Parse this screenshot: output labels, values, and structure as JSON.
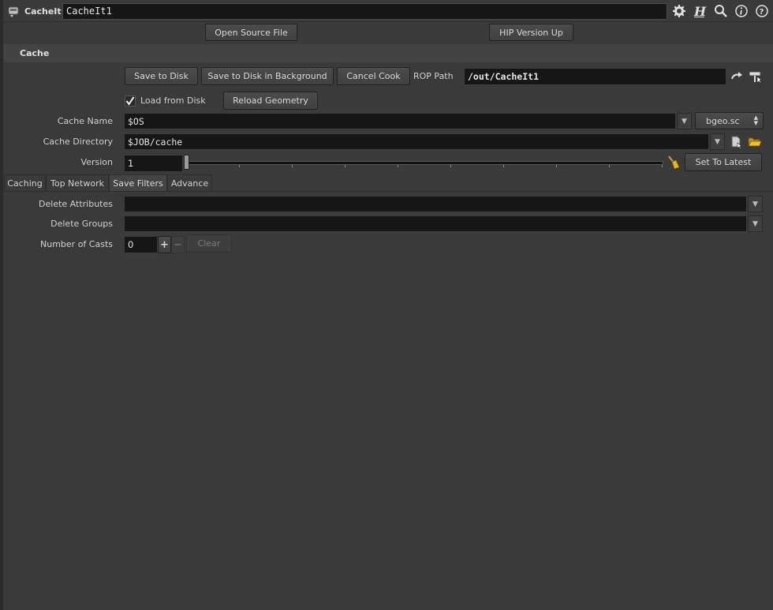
{
  "header": {
    "node_type": "CacheIt",
    "node_name": "CacheIt1",
    "icons": [
      "gear-icon",
      "houdini-h-icon",
      "search-icon",
      "info-icon",
      "help-icon"
    ]
  },
  "top_buttons": {
    "open_source": "Open Source File",
    "hip_version_up": "HIP Version Up"
  },
  "section": {
    "title": "Cache"
  },
  "cook_buttons": {
    "save_to_disk": "Save to Disk",
    "save_background": "Save to Disk in Background",
    "cancel_cook": "Cancel Cook"
  },
  "rop": {
    "label": "ROP Path",
    "value": "/out/CacheIt1"
  },
  "load": {
    "label": "Load from Disk",
    "checked": true,
    "reload": "Reload Geometry"
  },
  "cache_name": {
    "label": "Cache Name",
    "value": "$OS",
    "format": "bgeo.sc"
  },
  "cache_dir": {
    "label": "Cache Directory",
    "value": "$JOB/cache"
  },
  "version": {
    "label": "Version",
    "value": "1",
    "set_latest": "Set To Latest"
  },
  "tabs": [
    {
      "label": "Caching",
      "active": false
    },
    {
      "label": "Top Network",
      "active": false
    },
    {
      "label": "Save Filters",
      "active": true
    },
    {
      "label": "Advance",
      "active": false
    }
  ],
  "filters": {
    "delete_attributes": {
      "label": "Delete Attributes",
      "value": ""
    },
    "delete_groups": {
      "label": "Delete Groups",
      "value": ""
    },
    "number_of_casts": {
      "label": "Number of Casts",
      "value": "0",
      "plus": "+",
      "minus": "−",
      "clear": "Clear"
    }
  },
  "colors": {
    "background": "#3a3a3a",
    "field": "#161616",
    "section": "#434343",
    "folder": "#e0b020"
  }
}
